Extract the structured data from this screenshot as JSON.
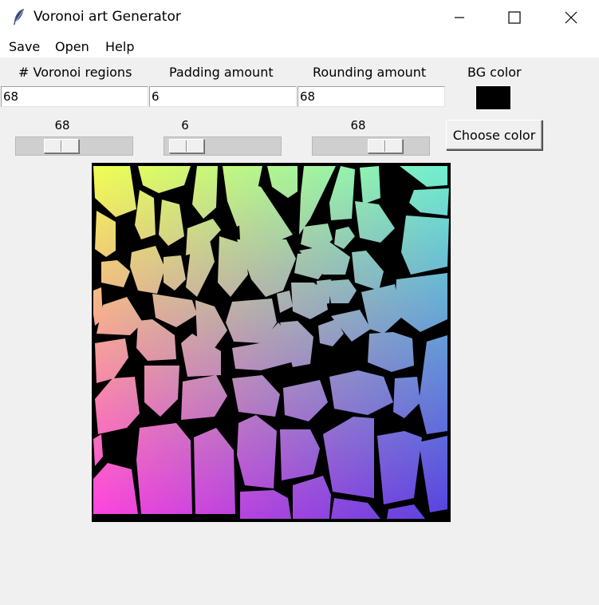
{
  "window": {
    "title": "Voronoi art Generator",
    "icon": "feather-icon",
    "controls": [
      "minimize-icon",
      "maximize-icon",
      "close-icon"
    ]
  },
  "menu": {
    "items": [
      {
        "label": "Save"
      },
      {
        "label": "Open"
      },
      {
        "label": "Help"
      }
    ]
  },
  "controls": {
    "regions": {
      "label": "# Voronoi regions",
      "value": "68",
      "scale_value": "68",
      "scale_fraction": 0.34
    },
    "padding": {
      "label": "Padding amount",
      "value": "6",
      "scale_value": "6",
      "scale_fraction": 0.06
    },
    "rounding": {
      "label": "Rounding amount",
      "value": "68",
      "scale_value": "68",
      "scale_fraction": 0.68
    },
    "bg_color": {
      "label": "BG color",
      "color": "#000000",
      "button_label": "Choose color"
    }
  },
  "canvas": {
    "background": "#000000",
    "gradient_colors": [
      "#f0ff50",
      "#70f0d0",
      "#ff40e0",
      "#5540e0"
    ]
  }
}
